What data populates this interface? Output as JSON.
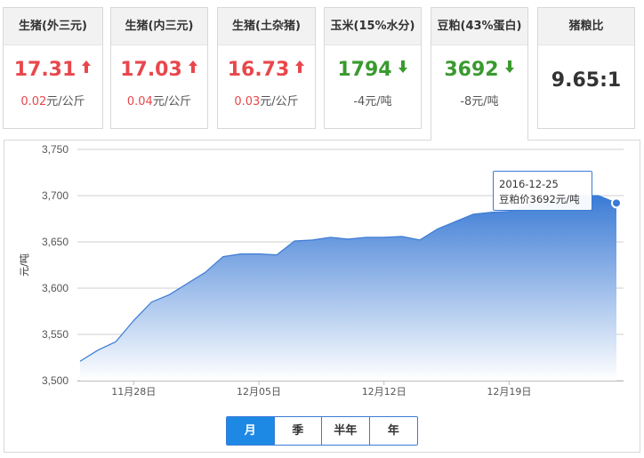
{
  "cards": [
    {
      "title": "生猪(外三元)",
      "price": "17.31",
      "trend": "up",
      "change_num": "0.02",
      "change_unit": "元/公斤"
    },
    {
      "title": "生猪(内三元)",
      "price": "17.03",
      "trend": "up",
      "change_num": "0.04",
      "change_unit": "元/公斤"
    },
    {
      "title": "生猪(土杂猪)",
      "price": "16.73",
      "trend": "up",
      "change_num": "0.03",
      "change_unit": "元/公斤"
    },
    {
      "title": "玉米(15%水分)",
      "price": "1794",
      "trend": "down",
      "change_num": "-4",
      "change_unit": "元/吨"
    },
    {
      "title": "豆粕(43%蛋白)",
      "price": "3692",
      "trend": "down",
      "change_num": "-8",
      "change_unit": "元/吨"
    },
    {
      "title": "猪粮比",
      "price": "9.65:1",
      "trend": "none",
      "change_num": "",
      "change_unit": ""
    }
  ],
  "active_card": 4,
  "tooltip": {
    "date": "2016-12-25",
    "text": "豆粕价3692元/吨"
  },
  "range_buttons": [
    "月",
    "季",
    "半年",
    "年"
  ],
  "selected_range": "月",
  "colors": {
    "up": "#e8474c",
    "down": "#3a9a2f",
    "accent": "#1e88e5",
    "area_top": "#3b7bd5",
    "area_bottom": "#ffffff"
  },
  "chart_data": {
    "type": "area",
    "title": "",
    "xlabel": "",
    "ylabel": "元/吨",
    "ylim": [
      3500,
      3750
    ],
    "yticks": [
      "3,500",
      "3,550",
      "3,600",
      "3,650",
      "3,700",
      "3,750"
    ],
    "xticks": [
      "11月28日",
      "12月05日",
      "12月12日",
      "12月19日"
    ],
    "grid": true,
    "legend": "none",
    "series": [
      {
        "x": [
          "2016-11-25",
          "2016-11-26",
          "2016-11-27",
          "2016-11-28",
          "2016-11-29",
          "2016-11-30",
          "2016-12-01",
          "2016-12-02",
          "2016-12-03",
          "2016-12-04",
          "2016-12-05",
          "2016-12-06",
          "2016-12-07",
          "2016-12-08",
          "2016-12-09",
          "2016-12-10",
          "2016-12-11",
          "2016-12-12",
          "2016-12-13",
          "2016-12-14",
          "2016-12-15",
          "2016-12-16",
          "2016-12-17",
          "2016-12-18",
          "2016-12-19",
          "2016-12-20",
          "2016-12-21",
          "2016-12-22",
          "2016-12-23",
          "2016-12-24",
          "2016-12-25"
        ],
        "values": [
          3521,
          3533,
          3542,
          3565,
          3585,
          3593,
          3605,
          3617,
          3634,
          3637,
          3637,
          3636,
          3651,
          3652,
          3655,
          3653,
          3655,
          3655,
          3656,
          3652,
          3664,
          3672,
          3680,
          3682,
          3683,
          3690,
          3694,
          3697,
          3700,
          3700,
          3692
        ]
      }
    ]
  }
}
